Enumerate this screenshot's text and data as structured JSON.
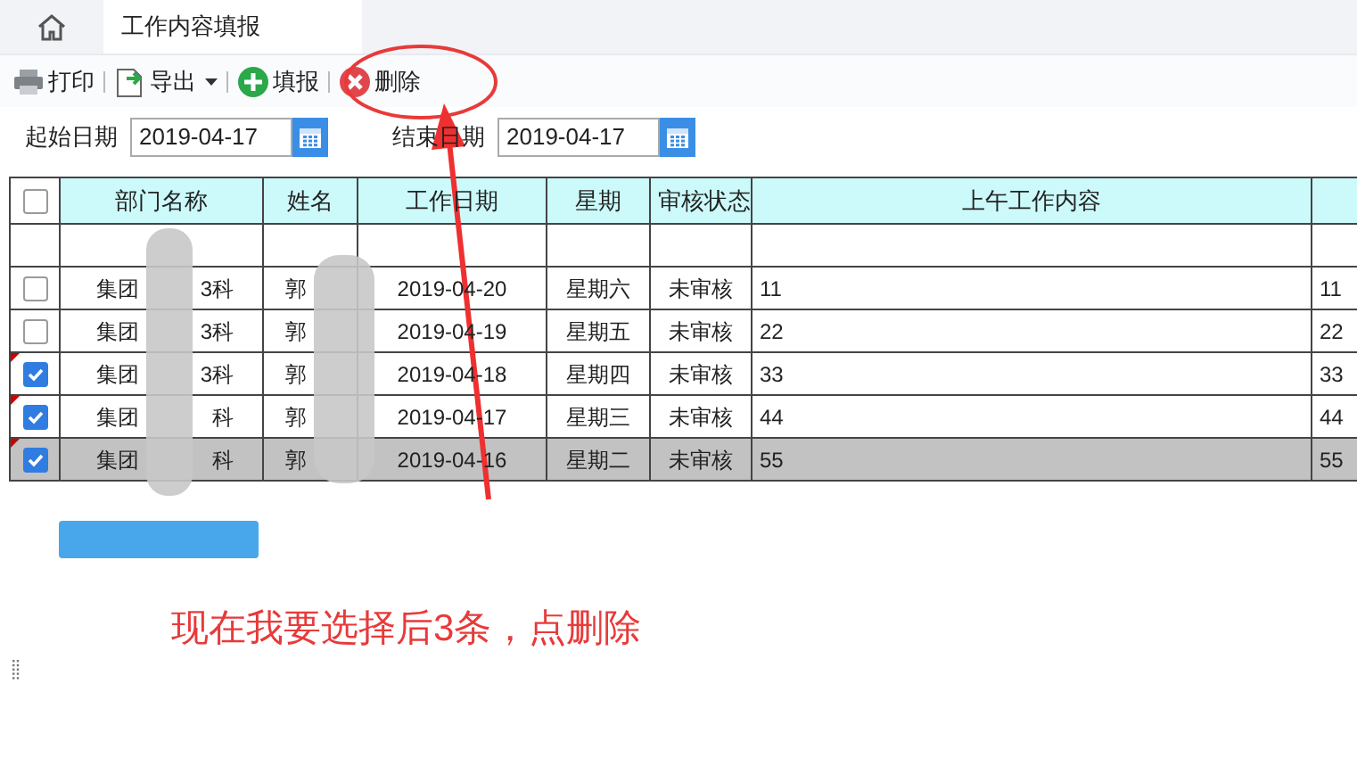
{
  "tabs": [
    {
      "kind": "home",
      "selected": false
    },
    {
      "kind": "text",
      "label": "工作内容填报",
      "selected": true
    }
  ],
  "toolbar": [
    {
      "kind": "print",
      "label": "打印"
    },
    {
      "kind": "export",
      "label": "导出",
      "dropdown": true
    },
    {
      "kind": "add",
      "label": "填报"
    },
    {
      "kind": "delete",
      "label": "删除"
    }
  ],
  "filters": [
    {
      "label": "起始日期",
      "value": "2019-04-17"
    },
    {
      "label": "结束日期",
      "value": "2019-04-17"
    }
  ],
  "table": {
    "all_checked": false,
    "columns": [
      "部门名称",
      "姓名",
      "工作日期",
      "星期",
      "审核状态",
      "上午工作内容"
    ],
    "rows": [
      {
        "checked": false,
        "selected": false,
        "dept": "集团",
        "dept_end": "3科",
        "name": "郭",
        "date": "2019-04-20",
        "weekday": "星期六",
        "status": "未审核",
        "morning": "11",
        "column_8": "11"
      },
      {
        "checked": false,
        "selected": false,
        "dept": "集团",
        "dept_end": "3科",
        "name": "郭",
        "date": "2019-04-19",
        "weekday": "星期五",
        "status": "未审核",
        "morning": "22",
        "column_8": "22"
      },
      {
        "checked": true,
        "selected": false,
        "dept": "集团",
        "dept_end": "3科",
        "name": "郭",
        "date": "2019-04-18",
        "weekday": "星期四",
        "status": "未审核",
        "morning": "33",
        "column_8": "33"
      },
      {
        "checked": true,
        "selected": false,
        "dept": "集团",
        "dept_end": "科",
        "name": "郭",
        "date": "2019-04-17",
        "weekday": "星期三",
        "status": "未审核",
        "morning": "44",
        "column_8": "44"
      },
      {
        "checked": true,
        "selected": true,
        "dept": "集团",
        "dept_end": "科",
        "name": "郭",
        "date": "2019-04-16",
        "weekday": "星期二",
        "status": "未审核",
        "morning": "55",
        "column_8": "55"
      }
    ]
  },
  "annotation": {
    "text": "现在我要选择后3条，点删除"
  }
}
